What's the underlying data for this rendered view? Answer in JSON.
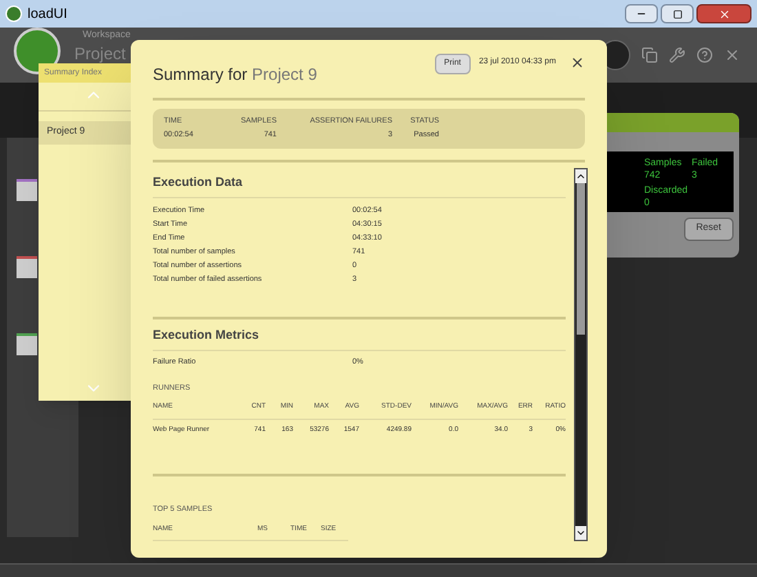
{
  "window": {
    "title": "loadUI"
  },
  "workspace": {
    "breadcrumb": "Workspace",
    "project_title": "Project"
  },
  "component": {
    "stats": [
      {
        "label": "Samples",
        "value": "742"
      },
      {
        "label": "Failed",
        "value": "3"
      },
      {
        "label": "Discarded",
        "value": "0"
      }
    ],
    "button": "Reset"
  },
  "summary_index": {
    "title": "Summary Index",
    "items": [
      {
        "label": "Project 9",
        "selected": true
      }
    ]
  },
  "summary": {
    "title": "Summary for",
    "project": "Project 9",
    "print_button": "Print",
    "date": "23 jul 2010 04:33 pm",
    "overview": {
      "columns": [
        "TIME",
        "SAMPLES",
        "ASSERTION FAILURES",
        "STATUS"
      ],
      "values": [
        "00:02:54",
        "741",
        "3",
        "Passed"
      ]
    },
    "execution_data": {
      "heading": "Execution Data",
      "rows": [
        {
          "label": "Execution Time",
          "value": "00:02:54"
        },
        {
          "label": "Start Time",
          "value": "04:30:15"
        },
        {
          "label": "End Time",
          "value": "04:33:10"
        },
        {
          "label": "Total number of samples",
          "value": "741"
        },
        {
          "label": "Total number of assertions",
          "value": "0"
        },
        {
          "label": "Total number of failed assertions",
          "value": "3"
        }
      ]
    },
    "execution_metrics": {
      "heading": "Execution Metrics",
      "rows": [
        {
          "label": "Failure Ratio",
          "value": "0%"
        }
      ]
    },
    "runners": {
      "heading": "RUNNERS",
      "columns": [
        "NAME",
        "CNT",
        "MIN",
        "MAX",
        "AVG",
        "STD-DEV",
        "MIN/AVG",
        "MAX/AVG",
        "ERR",
        "RATIO"
      ],
      "rows": [
        [
          "Web Page Runner",
          "741",
          "163",
          "53276",
          "1547",
          "4249.89",
          "0.0",
          "34.0",
          "3",
          "0%"
        ]
      ]
    },
    "top_samples": {
      "heading": "TOP 5 SAMPLES",
      "columns": [
        "NAME",
        "MS",
        "TIME",
        "SIZE"
      ]
    }
  }
}
